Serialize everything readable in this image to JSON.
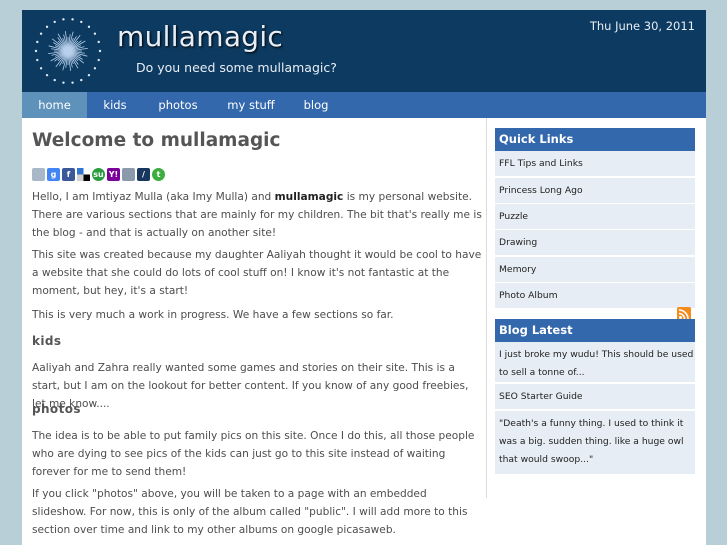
{
  "header": {
    "title": "mullamagic",
    "tagline": "Do you need some mullamagic?",
    "date": "Thu June 30, 2011"
  },
  "nav": {
    "items": [
      {
        "label": "home",
        "active": true
      },
      {
        "label": "kids"
      },
      {
        "label": "photos"
      },
      {
        "label": "my stuff"
      },
      {
        "label": "blog"
      }
    ]
  },
  "main": {
    "heading": "Welcome to mullamagic",
    "share_icons": [
      "diigo-icon",
      "google-icon",
      "facebook-icon",
      "delicious-icon",
      "stumbleupon-icon",
      "yahoo-icon",
      "print-icon",
      "livejournal-icon",
      "technorati-icon"
    ],
    "intro_before": "Hello, I am Imtiyaz Mulla (aka Imy Mulla) and ",
    "intro_bold": "mullamagic",
    "intro_after": " is my personal website. There are various sections that are mainly for my children. The bit that's really me is the blog - and that is actually on another site!",
    "para2": "This site was created because my daughter Aaliyah thought it would be cool to have a website that she could do lots of cool stuff on! I know it's not fantastic at the moment, but hey, it's a start!",
    "para3": "This is very much a work in progress. We have a few sections so far.",
    "kids_heading": "kids",
    "kids_text": "Aaliyah and Zahra really wanted some games and stories on their site. This is a start, but I am on the lookout for better content. If you know of any good freebies, let me know....",
    "photos_heading": "photos",
    "photos_text": "The idea is to be able to put family pics on this site. Once I do this, all those people who are dying to see pics of the kids can just go to this site instead of waiting forever for me to send them!",
    "photos_text2": "If you click \"photos\" above, you will be taken to a page with an embedded slideshow. For now, this is only of the album called \"public\". I will add more to this section over time and link to my other albums on google picasaweb."
  },
  "sidebar": {
    "quick_links_title": "Quick Links",
    "quick_links": [
      "FFL Tips and Links",
      "Princess Long Ago",
      "Puzzle",
      "Drawing",
      "Memory",
      "Photo Album"
    ],
    "blog_title": "Blog Latest",
    "blog_posts": [
      "I just broke my wudu! This should be used to sell a tonne of...",
      "SEO Starter Guide",
      "\"Death's a funny thing. I used to think it was a big. sudden thing. like a huge owl that would swoop...\""
    ]
  },
  "colors": {
    "header_bg": "#0c3a60",
    "nav_bg": "#3468ad",
    "nav_active_bg": "#5e92ba",
    "page_bg": "#b9cfd8",
    "sidebar_item_bg": "#e6edf4",
    "rss_orange": "#f38b1d"
  }
}
